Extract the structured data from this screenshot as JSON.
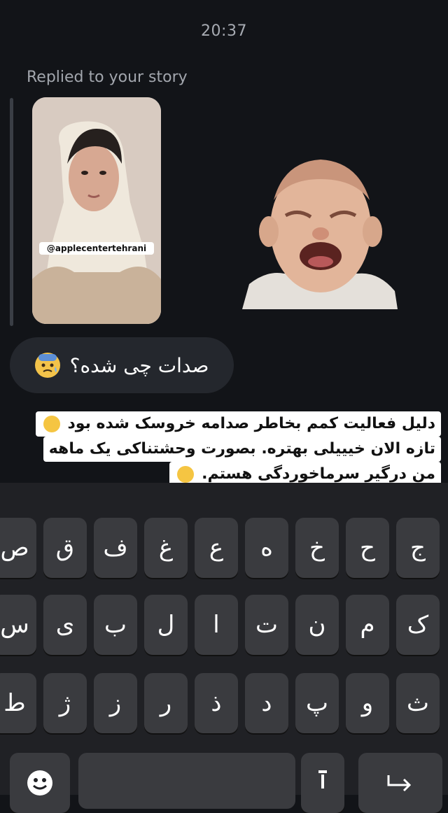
{
  "timestamp": "20:37",
  "reply_label": "Replied to your story",
  "story": {
    "tag": "@applecentertehrani"
  },
  "message": {
    "text": "صدات چی شده؟"
  },
  "caption": {
    "line1": "دلیل فعالیت کمم بخاطر صدامه خروسک شده بود",
    "line2": "تازه الان خیییلی بهتره. بصورت وحشتناکی یک ماهه",
    "line3": "من درگیر سرماخوردگی هستم."
  },
  "keyboard": {
    "row1": [
      "ج",
      "ح",
      "خ",
      "ه",
      "ع",
      "غ",
      "ف",
      "ق",
      "ص"
    ],
    "row2": [
      "ک",
      "م",
      "ن",
      "ت",
      "ا",
      "ل",
      "ب",
      "ی",
      "س"
    ],
    "row3": [
      "ث",
      "و",
      "پ",
      "د",
      "ذ",
      "ر",
      "ز",
      "ژ",
      "ط"
    ]
  }
}
